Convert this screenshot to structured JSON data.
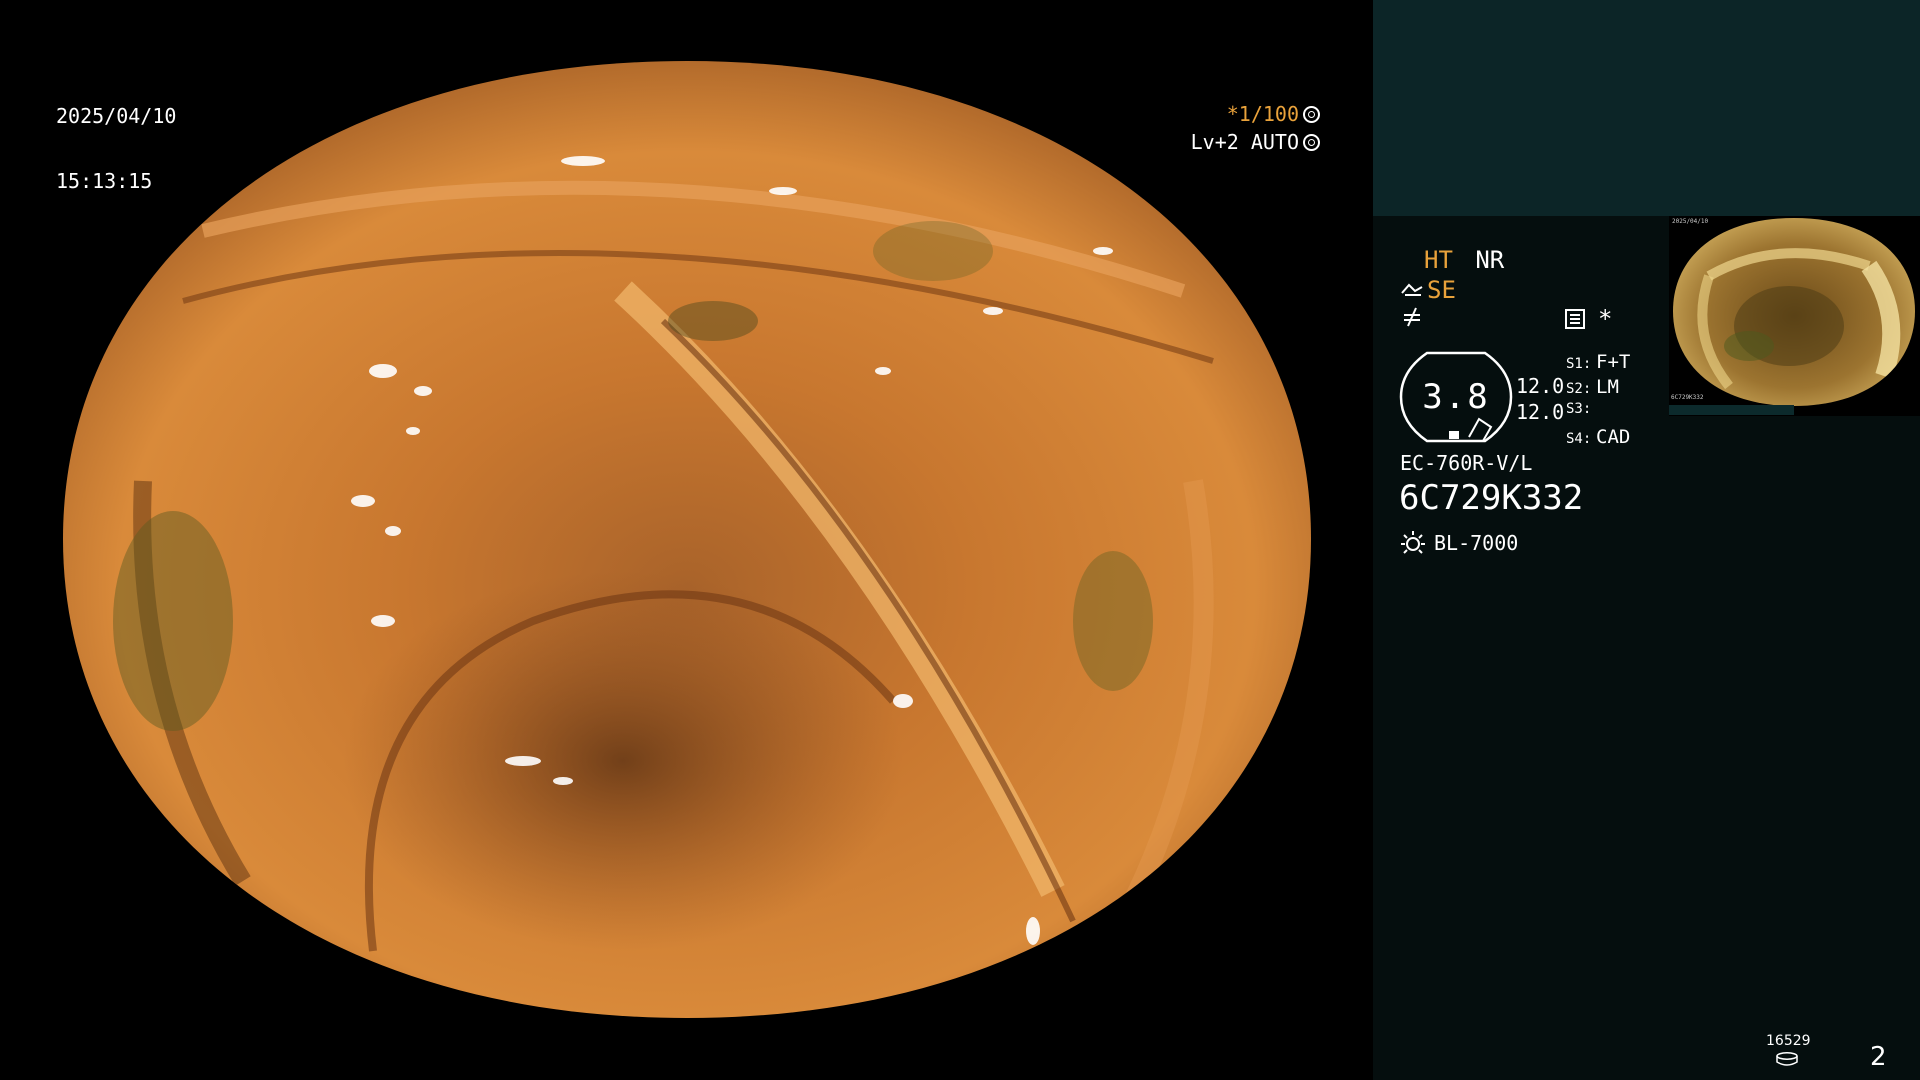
{
  "overlay": {
    "date": "2025/04/10",
    "time": "15:13:15",
    "shutter": "*1/100",
    "exposure": "Lv+2 AUTO"
  },
  "panel": {
    "mode_a": "HT",
    "mode_b": "NR",
    "enhance": "SE",
    "aux_symbol": "⁄",
    "star": "*",
    "gauge_value": "3.8",
    "gauge_values": [
      "12.0",
      "12.0"
    ],
    "scope_settings": [
      {
        "key": "S1:",
        "value": "F+T"
      },
      {
        "key": "S2:",
        "value": "LM"
      },
      {
        "key": "S3:",
        "value": ""
      },
      {
        "key": "S4:",
        "value": "CAD"
      }
    ],
    "scope_model": "EC-760R-V/L",
    "scope_serial": "6C729K332",
    "light_source": "BL-7000",
    "thumbnail": {
      "date": "2025/04/10",
      "scope_id": "6C729K332"
    },
    "storage_count": "16529",
    "page": "2"
  },
  "colors": {
    "accent_orange": "#e9a23b",
    "panel_dark": "#050e0e",
    "panel_teal": "#0c2527",
    "tissue": "#c7782e"
  }
}
